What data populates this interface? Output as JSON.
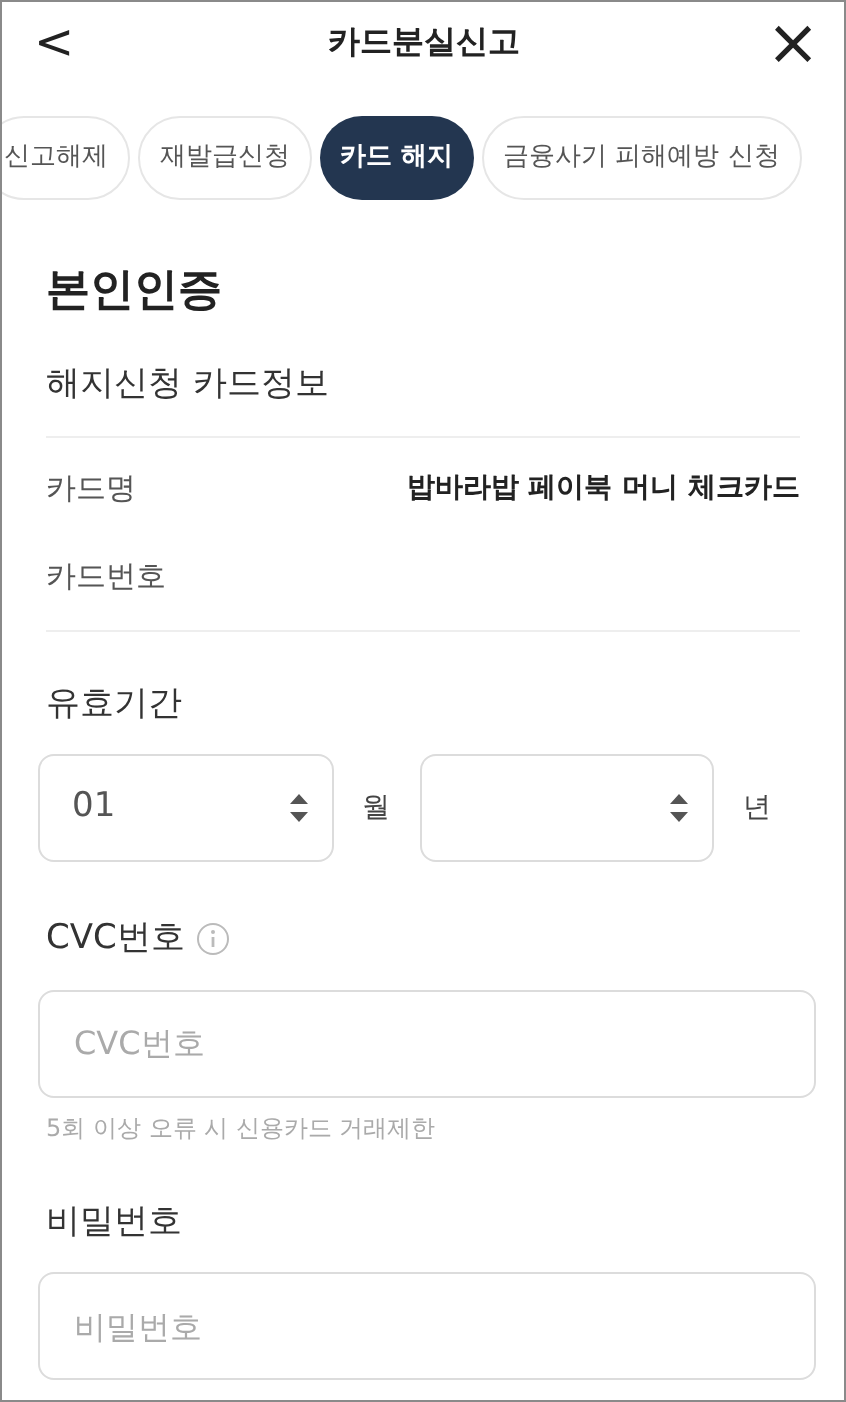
{
  "header": {
    "back": "<",
    "title": "카드분실신고",
    "close": "×"
  },
  "tabs": [
    {
      "label": "신고해제",
      "selected": false
    },
    {
      "label": "재발급신청",
      "selected": false
    },
    {
      "label": "카드 해지",
      "selected": true
    },
    {
      "label": "금융사기 피해예방 신청",
      "selected": false
    }
  ],
  "section_title": "본인인증",
  "card_info": {
    "title": "해지신청 카드정보",
    "rows": [
      {
        "label": "카드명",
        "value": "밥바라밥 페이북 머니 체크카드"
      },
      {
        "label": "카드번호"
      }
    ]
  },
  "expiry": {
    "label": "유효기간",
    "month": {
      "value": "01",
      "unit": "월"
    },
    "year": {
      "unit": "년"
    }
  },
  "cvc": {
    "label": "CVC번호",
    "placeholder": "CVC번호",
    "hint": "5회 이상 오류 시 신용카드 거래제한"
  },
  "password": {
    "label": "비밀번호",
    "placeholder": "비밀번호"
  }
}
